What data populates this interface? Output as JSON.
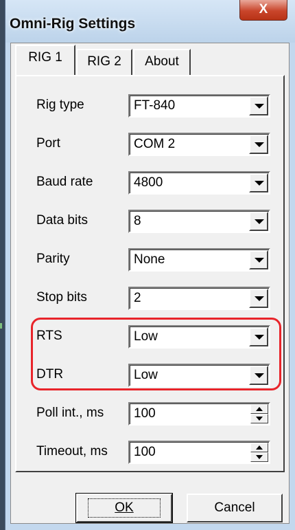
{
  "window": {
    "title": "Omni-Rig Settings",
    "close_label": "X"
  },
  "tabs": [
    {
      "label": "RIG 1",
      "active": true
    },
    {
      "label": "RIG 2",
      "active": false
    },
    {
      "label": "About",
      "active": false
    }
  ],
  "settings": {
    "rig_type": {
      "label": "Rig type",
      "value": "FT-840"
    },
    "port": {
      "label": "Port",
      "value": "COM 2"
    },
    "baud_rate": {
      "label": "Baud rate",
      "value": "4800"
    },
    "data_bits": {
      "label": "Data bits",
      "value": "8"
    },
    "parity": {
      "label": "Parity",
      "value": "None"
    },
    "stop_bits": {
      "label": "Stop bits",
      "value": "2"
    },
    "rts": {
      "label": "RTS",
      "value": "Low"
    },
    "dtr": {
      "label": "DTR",
      "value": "Low"
    },
    "poll_int": {
      "label": "Poll int., ms",
      "value": "100"
    },
    "timeout": {
      "label": "Timeout, ms",
      "value": "100"
    }
  },
  "buttons": {
    "ok": "OK",
    "cancel": "Cancel"
  },
  "colors": {
    "highlight": "#e8242a",
    "close_button": "#c9452b",
    "window_frame": "#c3d8ee"
  }
}
